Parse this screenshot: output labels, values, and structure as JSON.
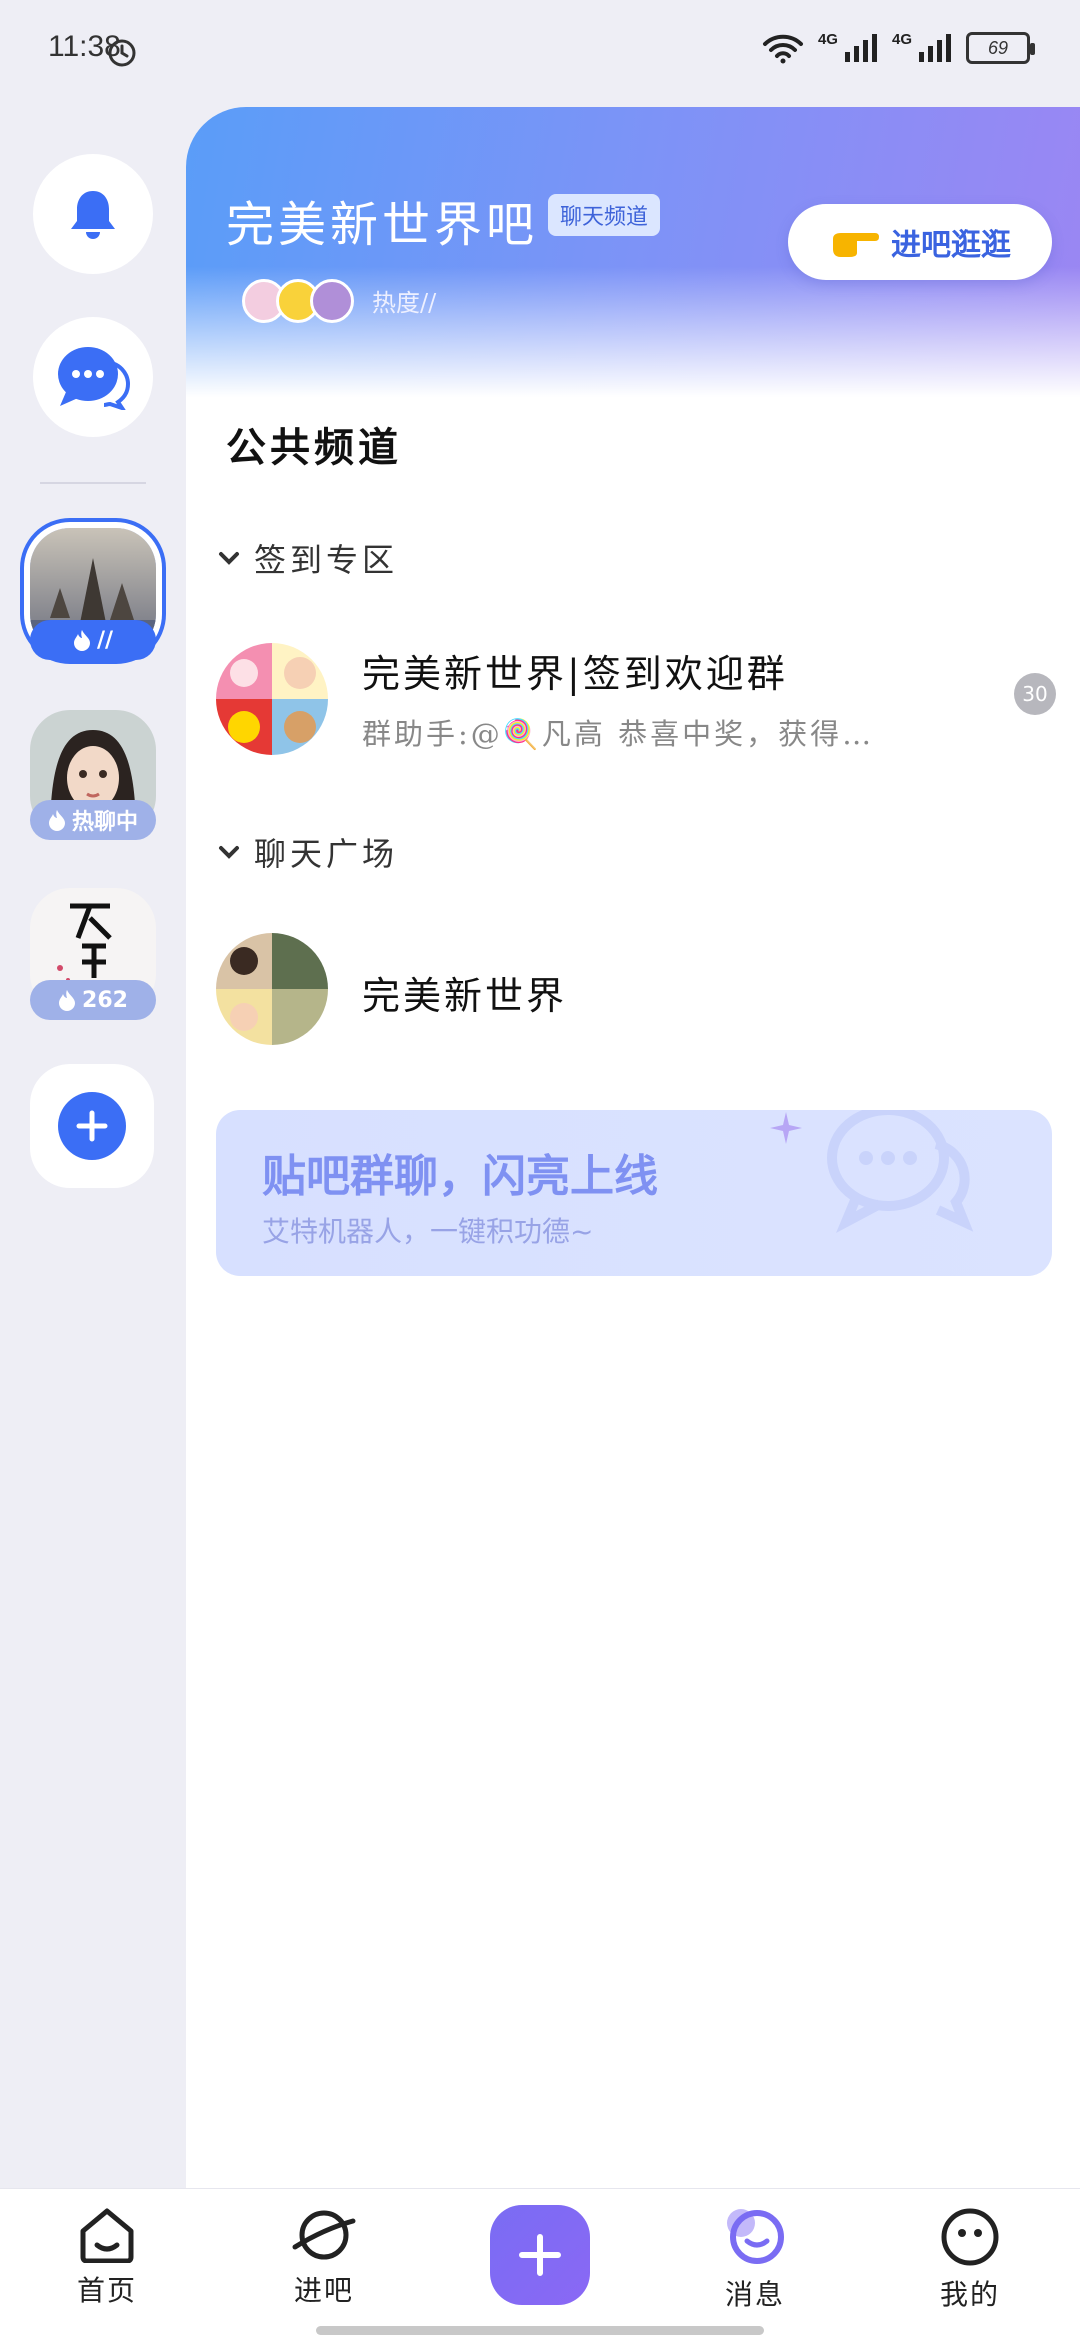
{
  "status_bar": {
    "time": "11:38",
    "network_label_1": "4G",
    "network_label_2": "4G",
    "battery": "69"
  },
  "rail": {
    "servers": [
      {
        "badge": "//"
      },
      {
        "badge": "热聊中"
      },
      {
        "badge": "262"
      }
    ]
  },
  "header": {
    "title": "完美新世界吧",
    "tag": "聊天频道",
    "heat_label": "热度//",
    "visit_label": "进吧逛逛"
  },
  "section_title": "公共频道",
  "groups": [
    {
      "header": "签到专区",
      "channels": [
        {
          "name": "完美新世界|签到欢迎群",
          "preview": "群助手:@🍭凡高 恭喜中奖，获得…",
          "unread": "30"
        }
      ]
    },
    {
      "header": "聊天广场",
      "channels": [
        {
          "name": "完美新世界"
        }
      ]
    }
  ],
  "promo": {
    "title": "贴吧群聊，闪亮上线",
    "subtitle": "艾特机器人，一键积功德~"
  },
  "bottom_nav": [
    {
      "label": "首页",
      "icon": "home-icon"
    },
    {
      "label": "进吧",
      "icon": "planet-icon"
    },
    {
      "label": "",
      "icon": "plus-icon"
    },
    {
      "label": "消息",
      "icon": "message-icon"
    },
    {
      "label": "我的",
      "icon": "profile-face-icon"
    }
  ],
  "colors": {
    "accent": "#3b6ef5",
    "purple": "#7a6cf3",
    "header_start": "#5a9df8",
    "header_end": "#9b86f3"
  }
}
